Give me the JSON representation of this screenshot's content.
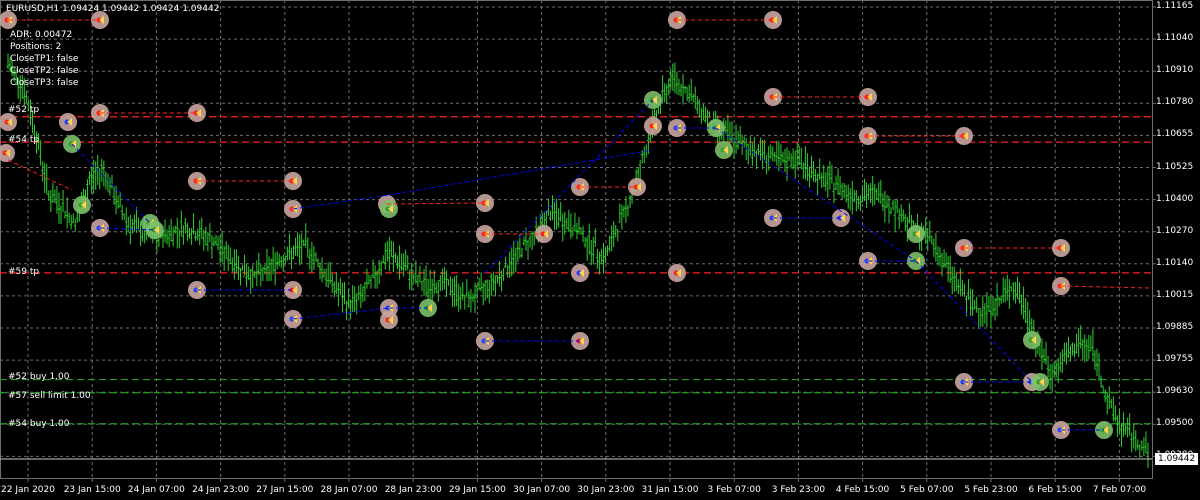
{
  "header": {
    "title": "EURUSD,H1  1.09424 1.09442 1.09424 1.09442"
  },
  "info_panel": [
    "ADR: 0.00472",
    "Positions: 2",
    "CloseTP1: false",
    "CloseTP2: false",
    "CloseTP3: false"
  ],
  "level_labels": [
    {
      "text": "#52 tp",
      "price": 1.10748,
      "color": "#ff2020"
    },
    {
      "text": "#54 tp",
      "price": 1.1065,
      "color": "#ff2020"
    },
    {
      "text": "#59 tp",
      "price": 1.10144,
      "color": "#ff2020"
    },
    {
      "text": "#52 buy 1.00",
      "price": 1.09731,
      "color": "#1fa01f"
    },
    {
      "text": "#57 sell limit 1.00",
      "price": 1.0968,
      "color": "#1fa01f"
    },
    {
      "text": "#54 buy 1.00",
      "price": 1.0956,
      "color": "#1fa01f"
    }
  ],
  "current_price": "1.09442",
  "colors": {
    "background": "#000000",
    "grid": "#6e6e6e",
    "candle": "#2fcf2f",
    "tp_line": "#ff2020",
    "entry_line": "#1fa01f",
    "trade_line": "#0000ff",
    "marker": "#c9a59e",
    "arrow": "#ffd24a"
  },
  "chart_data": {
    "type": "line",
    "symbol": "EURUSD",
    "timeframe": "H1",
    "y_ticks": [
      "1.11165",
      "1.11040",
      "1.10910",
      "1.10780",
      "1.10655",
      "1.10525",
      "1.10400",
      "1.10270",
      "1.10140",
      "1.10015",
      "1.09885",
      "1.09755",
      "1.09630",
      "1.09500",
      "1.09380"
    ],
    "x_ticks": [
      "22 Jan 2020",
      "23 Jan 15:00",
      "24 Jan 07:00",
      "24 Jan 23:00",
      "27 Jan 15:00",
      "28 Jan 07:00",
      "28 Jan 23:00",
      "29 Jan 15:00",
      "30 Jan 07:00",
      "30 Jan 23:00",
      "31 Jan 15:00",
      "3 Feb 07:00",
      "3 Feb 23:00",
      "4 Feb 15:00",
      "5 Feb 07:00",
      "5 Feb 23:00",
      "6 Feb 15:00",
      "7 Feb 07:00"
    ],
    "ylim": [
      1.0935,
      1.112
    ],
    "grid": true,
    "price_path": [
      1.1095,
      1.1088,
      1.107,
      1.1045,
      1.104,
      1.1033,
      1.105,
      1.1055,
      1.1042,
      1.1033,
      1.103,
      1.1028,
      1.103,
      1.1032,
      1.103,
      1.1027,
      1.1022,
      1.1017,
      1.1013,
      1.1015,
      1.102,
      1.1022,
      1.1025,
      1.1017,
      1.101,
      1.1002,
      1.1005,
      1.1013,
      1.1022,
      1.1018,
      1.1012,
      1.1009,
      1.1011,
      1.1007,
      1.1004,
      1.1008,
      1.1012,
      1.1018,
      1.1025,
      1.103,
      1.1038,
      1.1034,
      1.1031,
      1.1025,
      1.102,
      1.1033,
      1.1045,
      1.1062,
      1.108,
      1.109,
      1.1085,
      1.1078,
      1.1072,
      1.1068,
      1.1064,
      1.1062,
      1.106,
      1.1057,
      1.1059,
      1.1055,
      1.105,
      1.1049,
      1.1045,
      1.1044,
      1.1045,
      1.1041,
      1.1036,
      1.103,
      1.1028,
      1.1018,
      1.101,
      1.1002,
      1.1,
      1.1003,
      1.101,
      1.1,
      1.0985,
      1.0975,
      1.0982,
      1.0987,
      1.0985,
      1.0965,
      1.0955,
      1.095,
      1.0945
    ]
  }
}
